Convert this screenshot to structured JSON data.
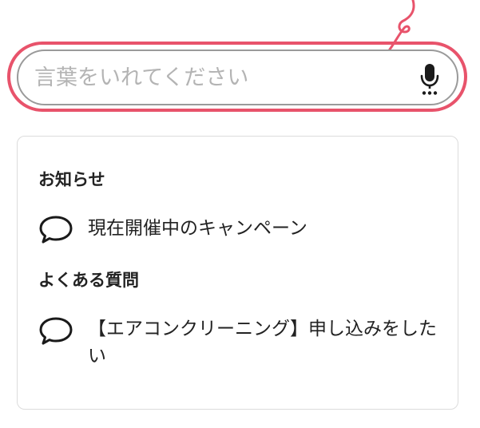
{
  "search": {
    "placeholder": "言葉をいれてください",
    "value": ""
  },
  "suggestions": {
    "sections": [
      {
        "title": "お知らせ",
        "items": [
          {
            "label": "現在開催中のキャンペーン"
          }
        ]
      },
      {
        "title": "よくある質問",
        "items": [
          {
            "label": "【エアコンクリーニング】申し込みをしたい"
          }
        ]
      }
    ]
  },
  "colors": {
    "highlight": "#e8536b",
    "input_border": "#9a9a9a",
    "placeholder": "#b4b4b4",
    "panel_border": "#dcdcdc",
    "text": "#222222"
  },
  "icons": {
    "search_action": "microphone-icon",
    "item": "speech-bubble-icon",
    "annotation": "curved-arrow-icon"
  }
}
